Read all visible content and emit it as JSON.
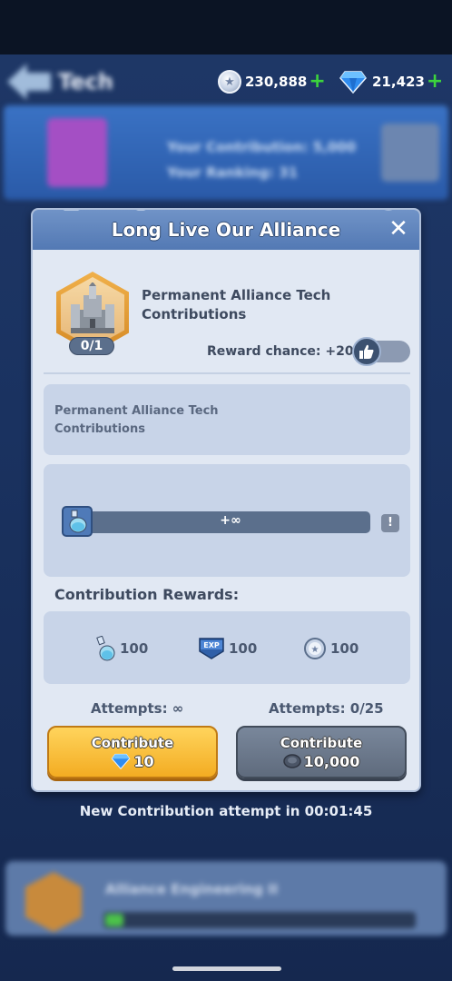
{
  "background": {
    "screen_title": "Tech",
    "banner_lines": [
      "Your Contribution: 5,000",
      "Your Ranking: 31"
    ],
    "bottom_card_title": "Alliance Engineering II"
  },
  "currencies": {
    "silver": "230,888",
    "gems": "21,423"
  },
  "dialog": {
    "title": "Long Live Our Alliance",
    "tech_name": "Permanent Alliance Tech Contributions",
    "counter": "0/1",
    "reward_chance": "Reward chance: +20%",
    "description": "Permanent Alliance Tech Contributions",
    "progress_label": "+∞",
    "rewards_title": "Contribution Rewards:",
    "rewards": [
      {
        "icon": "potion-icon",
        "amount": "100"
      },
      {
        "icon": "exp-icon",
        "amount": "100"
      },
      {
        "icon": "silver-coin-icon",
        "amount": "100"
      }
    ],
    "attempts_left": "Attempts: ∞",
    "attempts_right": "Attempts: 0/25",
    "contribute_gold": {
      "label": "Contribute",
      "cost": "10",
      "cost_icon": "gem-icon"
    },
    "contribute_gray": {
      "label": "Contribute",
      "cost": "10,000",
      "cost_icon": "silver-coin-icon"
    }
  },
  "timer_text": "New Contribution attempt in 00:01:45",
  "colors": {
    "gold_button": "#f3ac22",
    "gray_button": "#5f6b7d",
    "header_blue": "#5379b4",
    "plus_green": "#3cd43c"
  }
}
